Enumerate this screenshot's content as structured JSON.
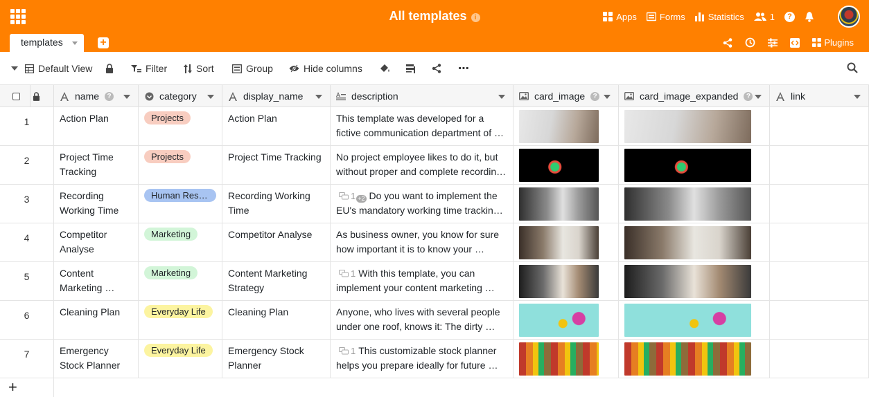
{
  "header": {
    "title": "All templates",
    "info_glyph": "i",
    "apps_label": "Apps",
    "forms_label": "Forms",
    "statistics_label": "Statistics",
    "collaborators_count": "1",
    "help_glyph": "?"
  },
  "tabs": {
    "active_label": "templates",
    "add_glyph": "+",
    "plugins_label": "Plugins"
  },
  "toolbar": {
    "view_label": "Default View",
    "filter_label": "Filter",
    "sort_label": "Sort",
    "group_label": "Group",
    "hide_columns_label": "Hide columns",
    "more_glyph": "⋯"
  },
  "columns": [
    {
      "label": "name",
      "type_icon": "text-icon",
      "has_help": true
    },
    {
      "label": "category",
      "type_icon": "single-select-icon",
      "has_help": false
    },
    {
      "label": "display_name",
      "type_icon": "text-icon",
      "has_help": false
    },
    {
      "label": "description",
      "type_icon": "long-text-icon",
      "has_help": false
    },
    {
      "label": "card_image",
      "type_icon": "image-icon",
      "has_help": true
    },
    {
      "label": "card_image_expanded",
      "type_icon": "image-icon",
      "has_help": true
    },
    {
      "label": "link",
      "type_icon": "text-icon",
      "has_help": false
    }
  ],
  "help_glyph": "?",
  "rows": [
    {
      "num": "1",
      "name": "Action Plan",
      "category": "Projects",
      "display_name": "Action Plan",
      "comment_count": "",
      "description": "This template was developed for a fictive communication department of …",
      "image": "sketch"
    },
    {
      "num": "2",
      "name": "Project Time Tracking",
      "category": "Projects",
      "display_name": "Project Time Tracking",
      "comment_count": "",
      "description": "No project employee likes to do it, but without proper and complete recordin…",
      "image": "watch"
    },
    {
      "num": "3",
      "name": "Recording Working Time",
      "category": "Human Reso…",
      "display_name": "Recording Working Time",
      "comment_count": "1",
      "comment_extra": "+2",
      "description": "Do you want to implement the EU's mandatory working time tracking …",
      "image": "clock"
    },
    {
      "num": "4",
      "name": "Competitor Analyse",
      "category": "Marketing",
      "display_name": "Competitor Analyse",
      "comment_count": "",
      "description": "As business owner, you know for sure how important it is to know your …",
      "image": "whiteboard"
    },
    {
      "num": "5",
      "name": "Content Marketing …",
      "category": "Marketing",
      "display_name": "Content Marketing Strategy",
      "comment_count": "1",
      "description": "With this template, you can implement your content marketing …",
      "image": "podcast"
    },
    {
      "num": "6",
      "name": "Cleaning Plan",
      "category": "Everyday Life",
      "display_name": "Cleaning Plan",
      "comment_count": "",
      "description": "Anyone, who lives with several people under one roof, knows it: The dirty …",
      "image": "cleaning"
    },
    {
      "num": "7",
      "name": "Emergency Stock Planner",
      "category": "Everyday Life",
      "display_name": "Emergency Stock Planner",
      "comment_count": "1",
      "description": "This customizable stock planner helps you prepare ideally for future …",
      "image": "jars"
    }
  ],
  "category_colors": {
    "Projects": "#f8cdc0",
    "Human Reso…": "#a8c4f2",
    "Marketing": "#d2f5d8",
    "Everyday Life": "#fcf4a0"
  },
  "add_row_glyph": "+",
  "colors": {
    "accent": "#ff8000"
  }
}
